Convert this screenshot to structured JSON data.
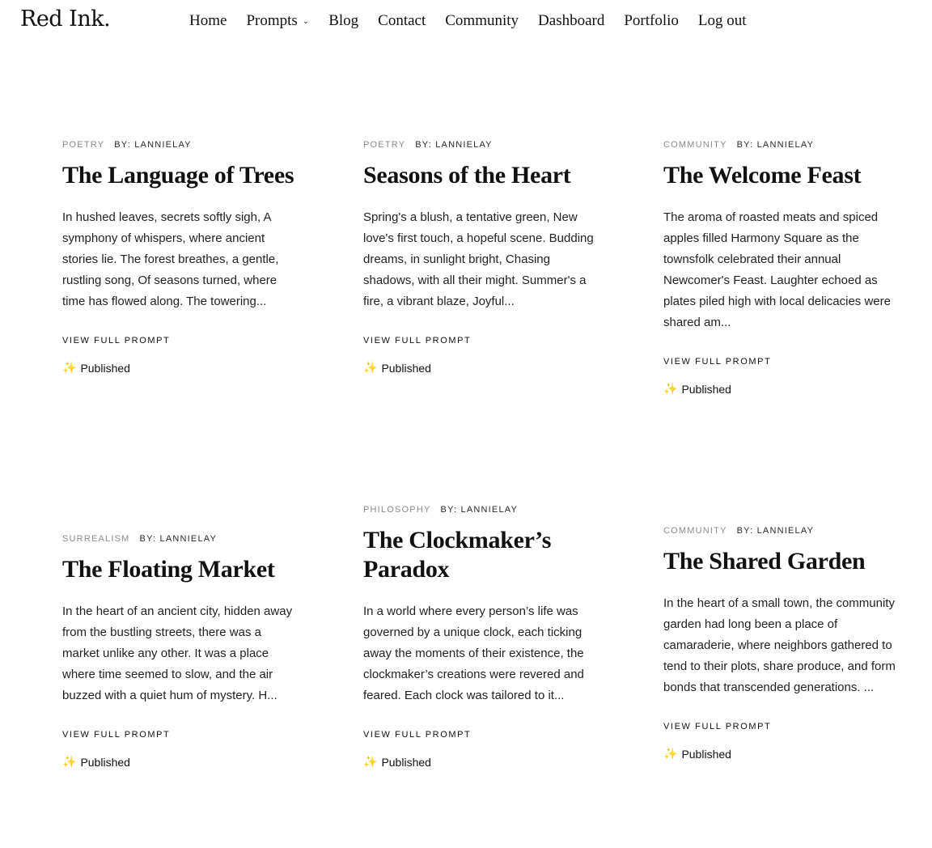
{
  "site": {
    "logo": "Red Ink."
  },
  "nav": {
    "items": [
      {
        "label": "Home",
        "name": "nav-home"
      },
      {
        "label": "Prompts",
        "name": "nav-prompts",
        "dropdown": true
      },
      {
        "label": "Blog",
        "name": "nav-blog"
      },
      {
        "label": "Contact",
        "name": "nav-contact"
      },
      {
        "label": "Community",
        "name": "nav-community"
      },
      {
        "label": "Dashboard",
        "name": "nav-dashboard"
      },
      {
        "label": "Portfolio",
        "name": "nav-portfolio"
      },
      {
        "label": "Log out",
        "name": "nav-logout"
      }
    ]
  },
  "cards": [
    {
      "category": "POETRY",
      "author": "BY: LANNIELAY",
      "title": "The Language of Trees",
      "excerpt": "In hushed leaves, secrets softly sigh, A symphony of whispers, where ancient stories lie. The forest breathes, a gentle, rustling song, Of seasons turned, where time has flowed along. The towering...",
      "link": "VIEW FULL PROMPT",
      "status": "Published"
    },
    {
      "category": "POETRY",
      "author": "BY: LANNIELAY",
      "title": "Seasons of the Heart",
      "excerpt": "Spring's a blush, a tentative green, New love's first touch, a hopeful scene. Budding dreams, in sunlight bright, Chasing shadows, with all their might. Summer's a fire, a vibrant blaze, Joyful...",
      "link": "VIEW FULL PROMPT",
      "status": "Published"
    },
    {
      "category": "COMMUNITY",
      "author": "BY: LANNIELAY",
      "title": "The Welcome Feast",
      "excerpt": "The aroma of roasted meats and spiced apples filled Harmony Square as the townsfolk celebrated their annual Newcomer's Feast. Laughter echoed as plates piled high with local delicacies were shared am...",
      "link": "VIEW FULL PROMPT",
      "status": "Published"
    },
    {
      "category": "SURREALISM",
      "author": "BY: LANNIELAY",
      "title": "The Floating Market",
      "excerpt": "In the heart of an ancient city, hidden away from the bustling streets, there was a market unlike any other. It was a place where time seemed to slow, and the air buzzed with a quiet hum of mystery. H...",
      "link": "VIEW FULL PROMPT",
      "status": "Published"
    },
    {
      "category": "PHILOSOPHY",
      "author": "BY: LANNIELAY",
      "title": "The Clockmaker’s Paradox",
      "excerpt": "In a world where every person’s life was governed by a unique clock, each ticking away the moments of their existence, the clockmaker’s creations were revered and feared. Each clock was tailored to it...",
      "link": "VIEW FULL PROMPT",
      "status": "Published"
    },
    {
      "category": "COMMUNITY",
      "author": "BY: LANNIELAY",
      "title": "The Shared Garden",
      "excerpt": "In the heart of a small town, the community garden had long been a place of camaraderie, where neighbors gathered to tend to their plots, share produce, and form bonds that transcended generations. ...",
      "link": "VIEW FULL PROMPT",
      "status": "Published"
    }
  ]
}
